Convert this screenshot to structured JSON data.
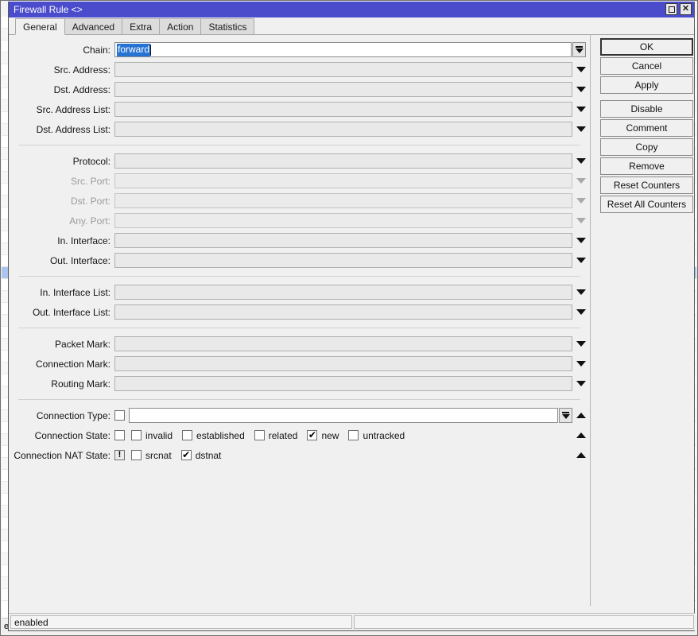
{
  "background_window": {
    "visible_sliver": true,
    "selected_row_color": "#aac6ef",
    "status_text": "e"
  },
  "window": {
    "title": "Firewall Rule <>",
    "titlebar_color": "#4a4ccc",
    "controls": [
      {
        "name": "maximize",
        "glyph": "box"
      },
      {
        "name": "close",
        "glyph": "✕"
      }
    ]
  },
  "tabs": [
    {
      "label": "General",
      "active": true
    },
    {
      "label": "Advanced",
      "active": false
    },
    {
      "label": "Extra",
      "active": false
    },
    {
      "label": "Action",
      "active": false
    },
    {
      "label": "Statistics",
      "active": false
    }
  ],
  "form": {
    "groups": [
      {
        "rows": [
          {
            "label": "Chain:",
            "value": "forward",
            "selected": true,
            "state": "active",
            "control": "combo-boxed"
          },
          {
            "label": "Src. Address:",
            "value": "",
            "state": "enabled",
            "control": "combo-plain"
          },
          {
            "label": "Dst. Address:",
            "value": "",
            "state": "enabled",
            "control": "combo-plain"
          },
          {
            "label": "Src. Address List:",
            "value": "",
            "state": "enabled",
            "control": "combo-plain"
          },
          {
            "label": "Dst. Address List:",
            "value": "",
            "state": "enabled",
            "control": "combo-plain"
          }
        ]
      },
      {
        "rows": [
          {
            "label": "Protocol:",
            "value": "",
            "state": "enabled",
            "control": "combo-plain"
          },
          {
            "label": "Src. Port:",
            "value": "",
            "state": "disabled",
            "control": "combo-plain"
          },
          {
            "label": "Dst. Port:",
            "value": "",
            "state": "disabled",
            "control": "combo-plain"
          },
          {
            "label": "Any. Port:",
            "value": "",
            "state": "disabled",
            "control": "combo-plain"
          },
          {
            "label": "In. Interface:",
            "value": "",
            "state": "enabled",
            "control": "combo-plain"
          },
          {
            "label": "Out. Interface:",
            "value": "",
            "state": "enabled",
            "control": "combo-plain"
          }
        ]
      },
      {
        "rows": [
          {
            "label": "In. Interface List:",
            "value": "",
            "state": "enabled",
            "control": "combo-plain"
          },
          {
            "label": "Out. Interface List:",
            "value": "",
            "state": "enabled",
            "control": "combo-plain"
          }
        ]
      },
      {
        "rows": [
          {
            "label": "Packet Mark:",
            "value": "",
            "state": "enabled",
            "control": "combo-plain"
          },
          {
            "label": "Connection Mark:",
            "value": "",
            "state": "enabled",
            "control": "combo-plain"
          },
          {
            "label": "Routing Mark:",
            "value": "",
            "state": "enabled",
            "control": "combo-plain"
          }
        ]
      }
    ],
    "connection_type": {
      "label": "Connection Type:",
      "negate_checked": false,
      "negate_glyph": "",
      "value": "",
      "collapse_icon": "chevron-up"
    },
    "connection_state": {
      "label": "Connection State:",
      "negate_checked": false,
      "negate_glyph": "",
      "collapse_icon": "chevron-up",
      "options": [
        {
          "label": "invalid",
          "checked": false
        },
        {
          "label": "established",
          "checked": false
        },
        {
          "label": "related",
          "checked": false
        },
        {
          "label": "new",
          "checked": true
        },
        {
          "label": "untracked",
          "checked": false
        }
      ]
    },
    "connection_nat_state": {
      "label": "Connection NAT State:",
      "negate_checked": true,
      "negate_glyph": "!",
      "collapse_icon": "chevron-up",
      "options": [
        {
          "label": "srcnat",
          "checked": false
        },
        {
          "label": "dstnat",
          "checked": true
        }
      ]
    },
    "check_glyph": "✔"
  },
  "buttons": [
    {
      "label": "OK",
      "default": true,
      "gap": false
    },
    {
      "label": "Cancel",
      "default": false,
      "gap": false
    },
    {
      "label": "Apply",
      "default": false,
      "gap": false
    },
    {
      "label": "Disable",
      "default": false,
      "gap": true
    },
    {
      "label": "Comment",
      "default": false,
      "gap": false
    },
    {
      "label": "Copy",
      "default": false,
      "gap": false
    },
    {
      "label": "Remove",
      "default": false,
      "gap": false
    },
    {
      "label": "Reset Counters",
      "default": false,
      "gap": false
    },
    {
      "label": "Reset All Counters",
      "default": false,
      "gap": false
    }
  ],
  "statusbar": {
    "left": "enabled",
    "right": ""
  }
}
